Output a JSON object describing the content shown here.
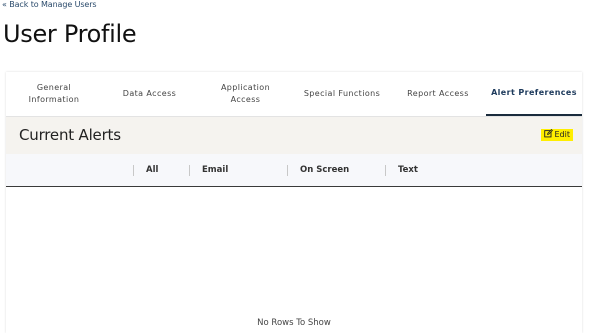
{
  "nav": {
    "back_link": "« Back to Manage Users"
  },
  "page": {
    "title": "User Profile"
  },
  "tabs": [
    {
      "label": "General Information",
      "active": false
    },
    {
      "label": "Data Access",
      "active": false
    },
    {
      "label": "Application Access",
      "active": false
    },
    {
      "label": "Special Functions",
      "active": false
    },
    {
      "label": "Report Access",
      "active": false
    },
    {
      "label": "Alert Preferences",
      "active": true
    }
  ],
  "alerts": {
    "title": "Current Alerts",
    "edit_label": "Edit",
    "edit_icon": "edit-icon",
    "edit_color": "#ffee00"
  },
  "grid": {
    "columns": [
      "All",
      "Email",
      "On Screen",
      "Text"
    ],
    "empty_text": "No Rows To Show"
  }
}
